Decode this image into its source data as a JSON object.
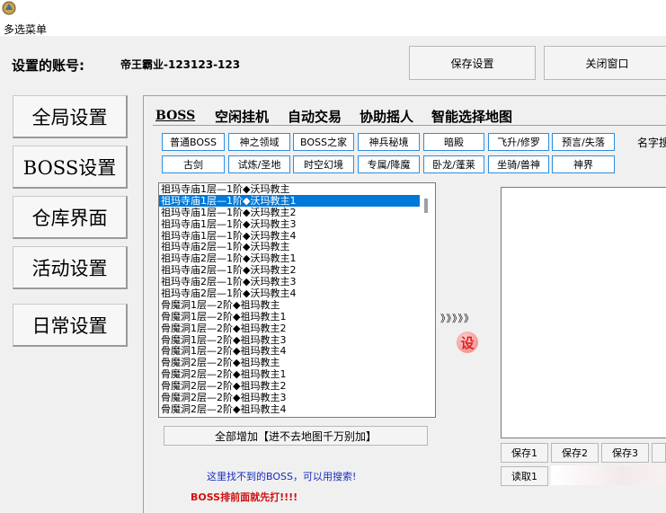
{
  "window": {
    "menu_title": "多选菜单"
  },
  "account": {
    "label": "设置的账号:",
    "value": "帝王霸业-123123-123"
  },
  "top_buttons": {
    "save": "保存设置",
    "close": "关闭窗口"
  },
  "sidebar": [
    "全局设置",
    "BOSS设置",
    "仓库界面",
    "活动设置",
    "日常设置"
  ],
  "tabs": [
    "BOSS",
    "空闲挂机",
    "自动交易",
    "协助摇人",
    "智能选择地图"
  ],
  "categories_row1": [
    "普通BOSS",
    "神之领域",
    "BOSS之家",
    "神兵秘境",
    "暗殿",
    "飞升/修罗",
    "预言/失落"
  ],
  "categories_row2": [
    "古剑",
    "试炼/圣地",
    "时空幻境",
    "专属/降魔",
    "卧龙/蓬莱",
    "坐骑/兽神",
    "神界"
  ],
  "name_search_label": "名字搜",
  "boss_list": [
    "祖玛寺庙1层—1阶◆沃玛教主",
    "祖玛寺庙1层—1阶◆沃玛教主1",
    "祖玛寺庙1层—1阶◆沃玛教主2",
    "祖玛寺庙1层—1阶◆沃玛教主3",
    "祖玛寺庙1层—1阶◆沃玛教主4",
    "祖玛寺庙2层—1阶◆沃玛教主",
    "祖玛寺庙2层—1阶◆沃玛教主1",
    "祖玛寺庙2层—1阶◆沃玛教主2",
    "祖玛寺庙2层—1阶◆沃玛教主3",
    "祖玛寺庙2层—1阶◆沃玛教主4",
    "骨魔洞1层—2阶◆祖玛教主",
    "骨魔洞1层—2阶◆祖玛教主1",
    "骨魔洞1层—2阶◆祖玛教主2",
    "骨魔洞1层—2阶◆祖玛教主3",
    "骨魔洞1层—2阶◆祖玛教主4",
    "骨魔洞2层—2阶◆祖玛教主",
    "骨魔洞2层—2阶◆祖玛教主1",
    "骨魔洞2层—2阶◆祖玛教主2",
    "骨魔洞2层—2阶◆祖玛教主3",
    "骨魔洞2层—2阶◆祖玛教主4"
  ],
  "selected_index": 1,
  "transfer_arrows": "》》》》》",
  "set_icon_label": "设",
  "add_all_button": "全部增加【进不去地图千万别加】",
  "hint_blue": "这里找不到的BOSS，可以用搜索!",
  "hint_red": "BOSS排前面就先打!!!!",
  "save_slots": [
    "保存1",
    "保存2",
    "保存3"
  ],
  "read_slot": "读取1",
  "colors": {
    "selection": "#0078d7",
    "category_border": "#2f8fe0",
    "hint_blue": "#1a2bbd",
    "hint_red": "#d01010"
  }
}
